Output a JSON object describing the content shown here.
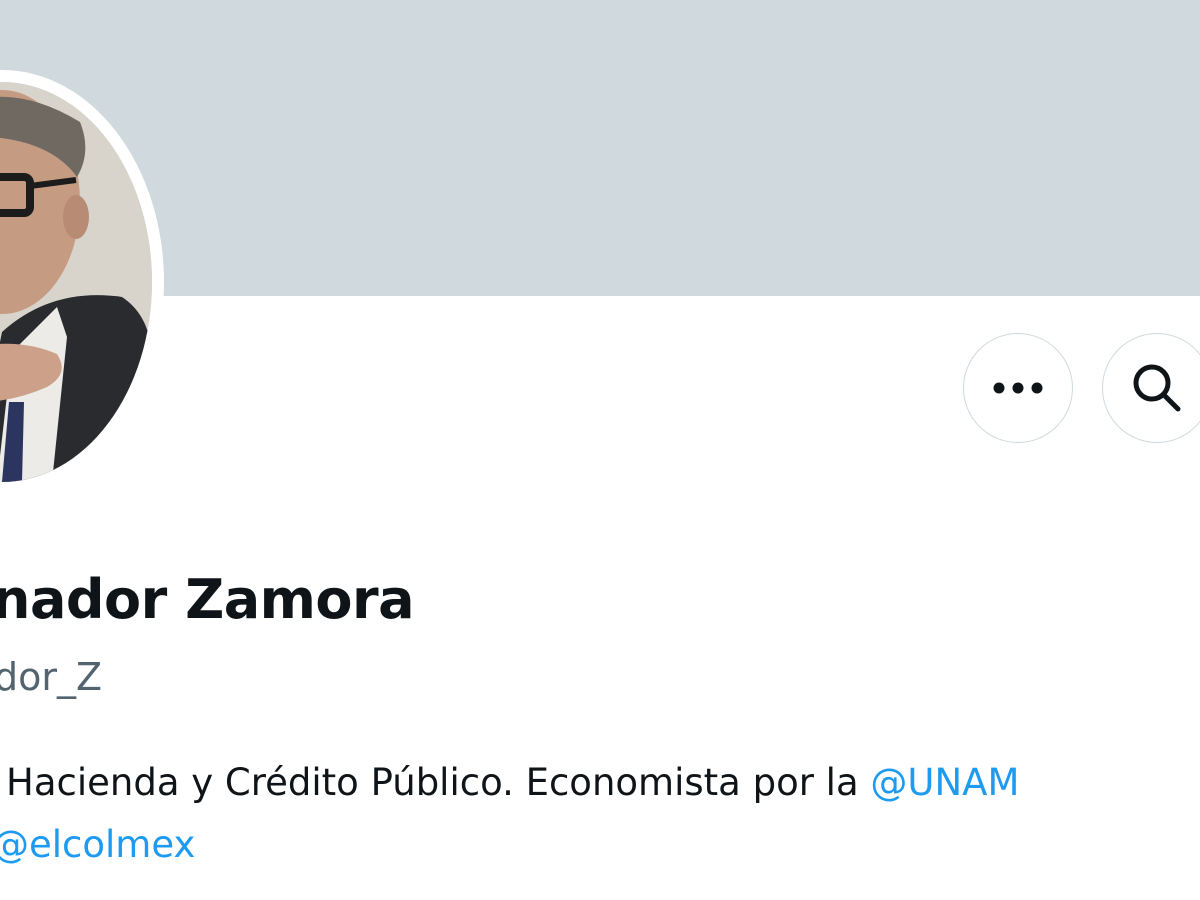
{
  "profile": {
    "display_name": "nador Zamora",
    "handle": "dor_Z",
    "bio": {
      "line1_text": "Hacienda y Crédito Público. Economista por la ",
      "line1_mention": "@UNAM",
      "line2_mention": "@elcolmex"
    }
  },
  "actions": {
    "more_icon": "more-horizontal-icon",
    "search_icon": "search-icon"
  },
  "colors": {
    "banner": "#cfd9de",
    "text_primary": "#0f1419",
    "text_secondary": "#536471",
    "link": "#1d9bf0",
    "button_border": "#cfd9de"
  }
}
